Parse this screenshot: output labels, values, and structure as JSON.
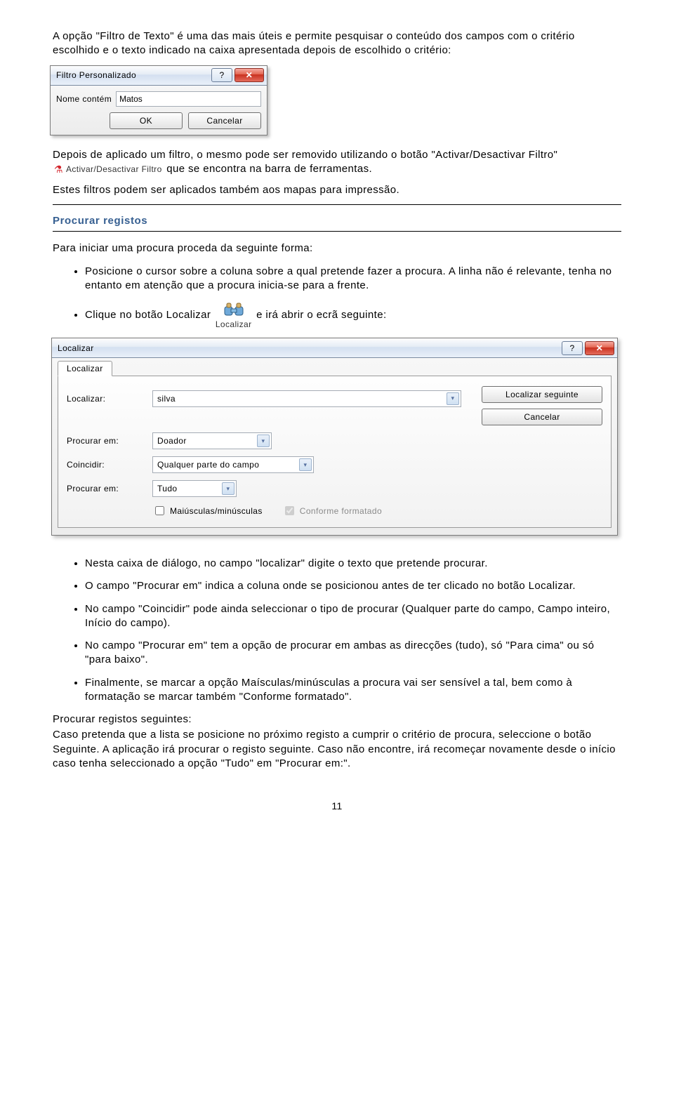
{
  "para_intro": "A opção \"Filtro de Texto\" é uma das mais úteis e permite pesquisar o conteúdo dos campos com o critério escolhido e o texto indicado na caixa apresentada depois de escolhido o critério:",
  "filtro_dlg": {
    "title": "Filtro Personalizado",
    "field_label": "Nome contém",
    "field_value": "Matos",
    "ok": "OK",
    "cancel": "Cancelar"
  },
  "para_after_prefix": "Depois de aplicado um filtro, o mesmo pode ser removido utilizando o botão \"Activar/Desactivar Filtro\" ",
  "toolbtn_label": "Activar/Desactivar Filtro",
  "para_after_suffix": " que se encontra na barra de ferramentas.",
  "para_mapfilters": "Estes filtros podem ser aplicados também aos mapas para impressão.",
  "heading_procurar": "Procurar registos",
  "para_proc_intro": "Para iniciar uma procura proceda da seguinte forma:",
  "bullet1": "Posicione o cursor sobre a coluna sobre a qual pretende fazer a procura. A linha não é relevante, tenha no entanto em atenção que a procura inicia-se para a frente.",
  "bullet2_prefix": "Clique no botão Localizar ",
  "binoc_label": "Localizar",
  "bullet2_suffix": " e irá abrir o ecrã seguinte:",
  "loc_dlg": {
    "title": "Localizar",
    "tab": "Localizar",
    "lbl_localizar": "Localizar:",
    "val_localizar": "silva",
    "btn_next": "Localizar seguinte",
    "btn_cancel": "Cancelar",
    "lbl_procurar_em1": "Procurar em:",
    "val_procurar_em1": "Doador",
    "lbl_coincidir": "Coincidir:",
    "val_coincidir": "Qualquer parte do campo",
    "lbl_procurar_em2": "Procurar em:",
    "val_procurar_em2": "Tudo",
    "chk_case": "Maiúsculas/minúsculas",
    "chk_fmt": "Conforme formatado"
  },
  "ul_after": {
    "b1": "Nesta caixa de diálogo, no campo \"localizar\" digite o texto que pretende procurar.",
    "b2": "O campo \"Procurar em\" indica a coluna onde se posicionou antes de ter clicado no botão Localizar.",
    "b3": "No campo \"Coincidir\" pode ainda seleccionar o tipo de procurar (Qualquer parte do campo, Campo inteiro, Início do campo).",
    "b4": "No campo \"Procurar em\" tem a opção de procurar em ambas as direcções (tudo), só \"Para cima\" ou só \"para baixo\".",
    "b5": "Finalmente, se marcar a opção Maísculas/minúsculas a procura vai ser sensível a tal, bem como à formatação se marcar também \"Conforme formatado\"."
  },
  "seg_heading": "Procurar registos seguintes:",
  "seg_body": "Caso pretenda que a lista se posicione no próximo registo a cumprir o critério de procura, seleccione o botão Seguinte. A aplicação irá procurar o registo seguinte. Caso não encontre, irá recomeçar novamente desde o início caso tenha seleccionado a opção \"Tudo\" em \"Procurar em:\".",
  "page_number": "11"
}
